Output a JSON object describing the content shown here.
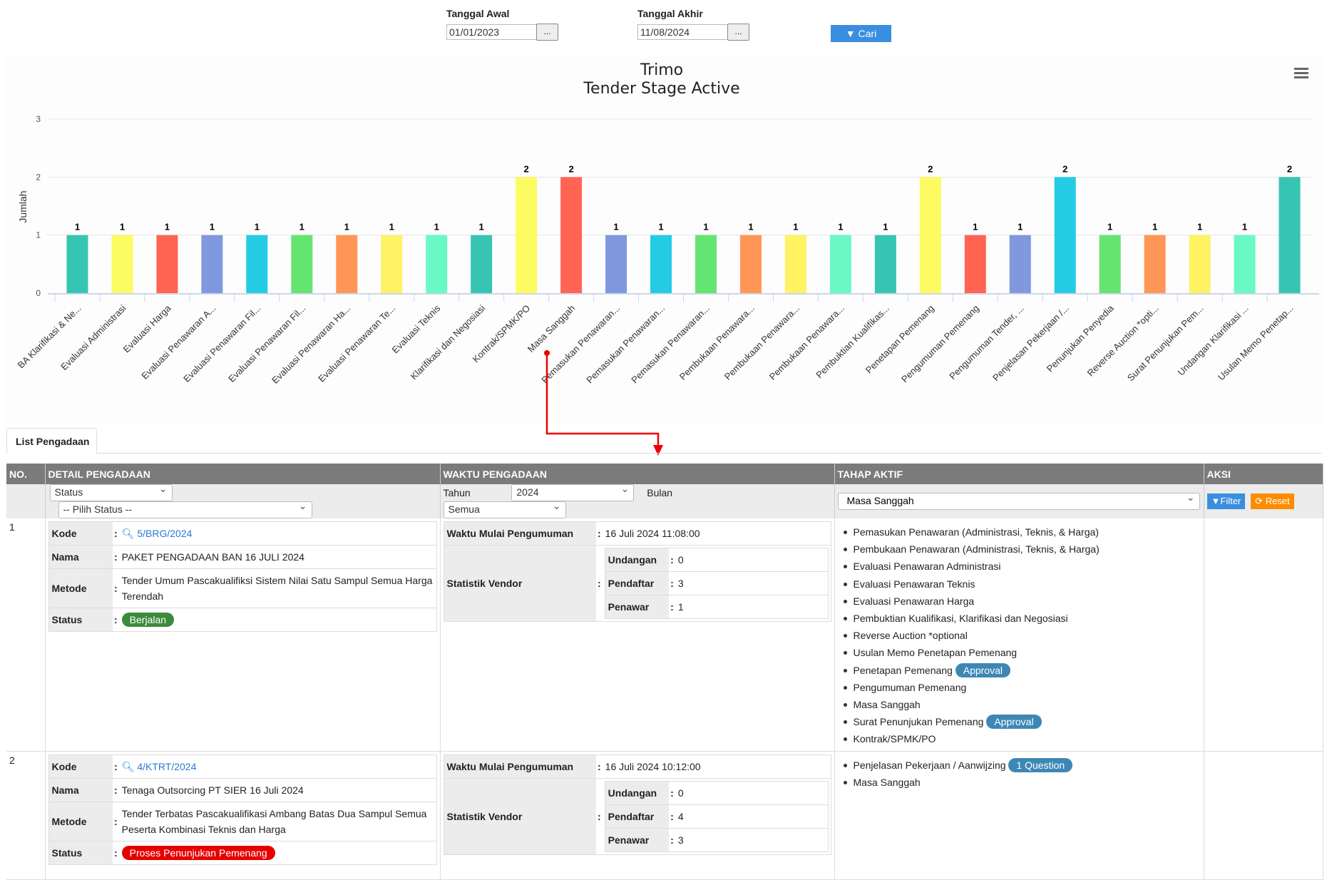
{
  "filters": {
    "start_label": "Tanggal Awal",
    "start_value": "01/01/2023",
    "end_label": "Tanggal Akhir",
    "end_value": "11/08/2024",
    "picker_label": "...",
    "search_label": "Cari"
  },
  "chart_data": {
    "type": "bar",
    "title": "Trimo",
    "subtitle": "Tender Stage Active",
    "xlabel": "",
    "ylabel": "Jumlah",
    "ylim": [
      0,
      3
    ],
    "yticks": [
      0,
      1,
      2,
      3
    ],
    "grid": true,
    "categories": [
      "BA Klarifikasi & Ne...",
      "Evaluasi Administrasi",
      "Evaluasi Harga",
      "Evaluasi Penawaran A...",
      "Evaluasi Penawaran Fil...",
      "Evaluasi Penawaran Fil...",
      "Evaluasi Penawaran Ha...",
      "Evaluasi Penawaran Te...",
      "Evaluasi Teknis",
      "Klarifikasi dan Negosiasi",
      "Kontrak/SPMK/PO",
      "Masa Sanggah",
      "Pemasukan Penawaran...",
      "Pemasukan Penawaran...",
      "Pemasukan Penawaran...",
      "Pembukaan Penawara...",
      "Pembukaan Penawara...",
      "Pembukaan Penawara...",
      "Pembuktian Kualifikas...",
      "Penetapan Pemenang",
      "Pengumuman Pemenang",
      "Pengumuman Tender, ...",
      "Penjelasan Pekerjaan /...",
      "Penunjukan Penyedia",
      "Reverse Auction *opti...",
      "Surat Penunjukan Pem...",
      "Undangan Klarifikasi ...",
      "Usulan Memo Penetap..."
    ],
    "values": [
      1,
      1,
      1,
      1,
      1,
      1,
      1,
      1,
      1,
      1,
      2,
      2,
      1,
      1,
      1,
      1,
      1,
      1,
      1,
      2,
      1,
      1,
      2,
      1,
      1,
      1,
      1,
      2
    ],
    "colors": [
      "#36c5b3",
      "#fdfb62",
      "#ff6552",
      "#7f98de",
      "#24cbe5",
      "#64e572",
      "#ff9655",
      "#fff263",
      "#6af9c4"
    ]
  },
  "tab": {
    "label": "List Pengadaan"
  },
  "table": {
    "headers": [
      "NO.",
      "DETAIL PENGADAAN",
      "WAKTU PENGADAAN",
      "TAHAP AKTIF",
      "AKSI"
    ],
    "filter_row": {
      "status_field": "Status",
      "status_choice": "-- Pilih Status --",
      "year_label": "Tahun",
      "year_value": "2024",
      "month_label": "Bulan",
      "month_value": "Semua",
      "stage_value": "Masa Sanggah",
      "filter_label": "Filter",
      "reset_label": "Reset"
    },
    "labels": {
      "kode": "Kode",
      "nama": "Nama",
      "metode": "Metode",
      "status": "Status",
      "colon": ":",
      "waktu_mulai": "Waktu Mulai Pengumuman",
      "statistik": "Statistik Vendor",
      "undangan": "Undangan",
      "pendaftar": "Pendaftar",
      "penawar": "Penawar"
    },
    "rows": [
      {
        "no": "1",
        "kode": "5/BRG/2024",
        "nama": "PAKET PENGADAAN BAN 16 JULI 2024",
        "metode": "Tender Umum Pascakualifiksi Sistem Nilai Satu Sampul Semua Harga Terendah",
        "status": "Berjalan",
        "status_color": "#3c8b3c",
        "waktu_mulai": "16 Juli 2024 11:08:00",
        "undangan": "0",
        "pendaftar": "3",
        "penawar": "1",
        "stages": [
          {
            "text": "Pemasukan Penawaran (Administrasi, Teknis, & Harga)"
          },
          {
            "text": "Pembukaan Penawaran (Administrasi, Teknis, & Harga)"
          },
          {
            "text": "Evaluasi Penawaran Administrasi"
          },
          {
            "text": "Evaluasi Penawaran Teknis"
          },
          {
            "text": "Evaluasi Penawaran Harga"
          },
          {
            "text": "Pembuktian Kualifikasi, Klarifikasi dan Negosiasi"
          },
          {
            "text": "Reverse Auction *optional"
          },
          {
            "text": "Usulan Memo Penetapan Pemenang"
          },
          {
            "text": "Penetapan Pemenang",
            "badge": "Approval"
          },
          {
            "text": "Pengumuman Pemenang"
          },
          {
            "text": "Masa Sanggah"
          },
          {
            "text": "Surat Penunjukan Pemenang",
            "badge": "Approval"
          },
          {
            "text": "Kontrak/SPMK/PO"
          }
        ]
      },
      {
        "no": "2",
        "kode": "4/KTRT/2024",
        "nama": "Tenaga Outsorcing PT SIER 16 Juli 2024",
        "metode": "Tender Terbatas Pascakualifikasi Ambang Batas Dua Sampul Semua Peserta Kombinasi Teknis dan Harga",
        "status": "Proses Penunjukan Pemenang",
        "status_color": "#e60000",
        "waktu_mulai": "16 Juli 2024 10:12:00",
        "undangan": "0",
        "pendaftar": "4",
        "penawar": "3",
        "stages": [
          {
            "text": "Penjelasan Pekerjaan / Aanwijzing",
            "badge": "1 Question"
          },
          {
            "text": "Masa Sanggah"
          }
        ]
      }
    ]
  }
}
